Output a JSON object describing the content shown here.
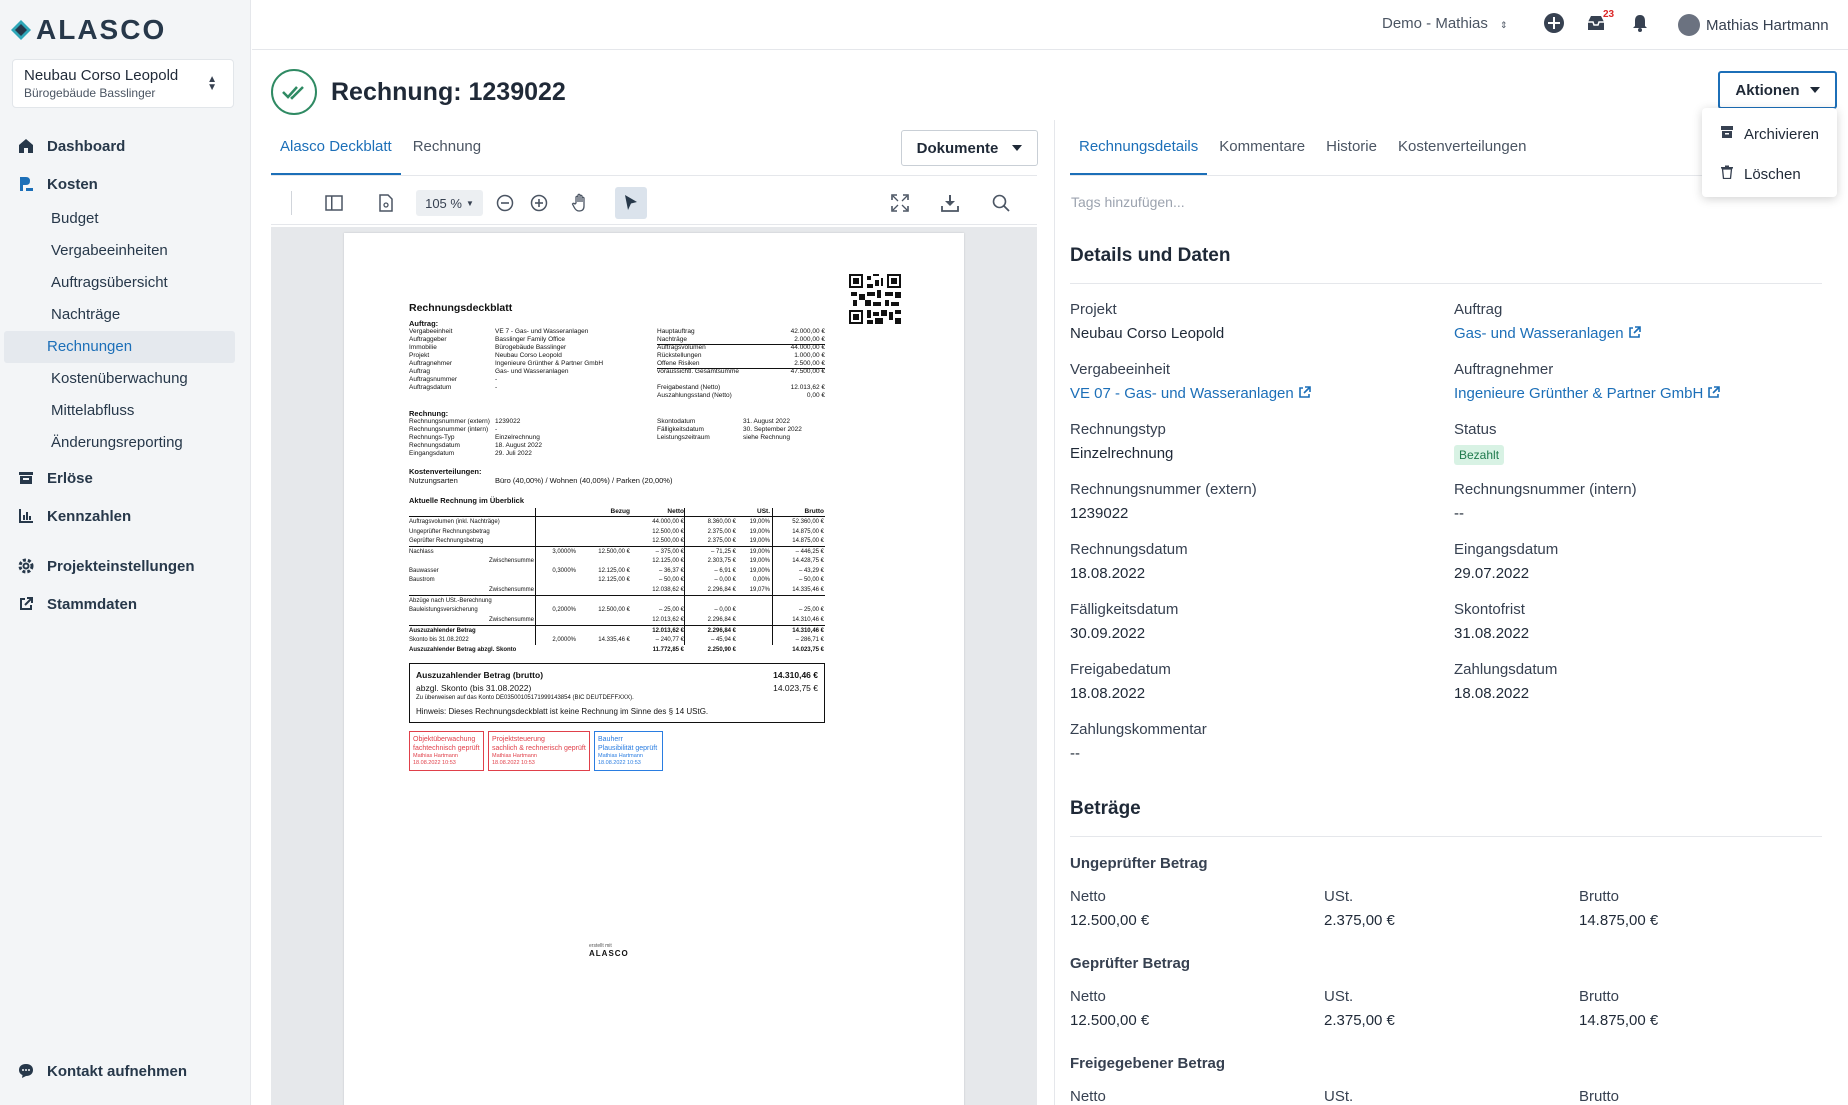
{
  "sidebar": {
    "logo_text": "ALASCO",
    "project": {
      "name": "Neubau Corso Leopold",
      "building": "Bürogebäude Basslinger"
    },
    "nav": {
      "dashboard": "Dashboard",
      "kosten": "Kosten",
      "budget": "Budget",
      "vergabeeinheiten": "Vergabeeinheiten",
      "auftragsuebersicht": "Auftragsübersicht",
      "nachtraege": "Nachträge",
      "rechnungen": "Rechnungen",
      "kostenueberwachung": "Kostenüberwachung",
      "mittelabfluss": "Mittelabfluss",
      "aenderungsreporting": "Änderungsreporting",
      "erloese": "Erlöse",
      "kennzahlen": "Kennzahlen",
      "projekteinstellungen": "Projekteinstellungen",
      "stammdaten": "Stammdaten",
      "kontakt": "Kontakt aufnehmen"
    }
  },
  "topbar": {
    "org": "Demo - Mathias",
    "inbox_badge": "23",
    "user_name": "Mathias Hartmann"
  },
  "page": {
    "title": "Rechnung: 1239022",
    "actions_label": "Aktionen",
    "actions_menu": {
      "archive": "Archivieren",
      "delete": "Löschen"
    }
  },
  "left_panel": {
    "tabs": {
      "deckblatt": "Alasco Deckblatt",
      "rechnung": "Rechnung"
    },
    "documents_button": "Dokumente",
    "zoom": "105 %"
  },
  "pdf": {
    "heading": "Rechnungsdeckblatt",
    "auftrag_heading": "Auftrag:",
    "auftrag_rows": [
      [
        "Vergabeeinheit",
        "VE 7 - Gas- und Wasseranlagen"
      ],
      [
        "Auftraggeber",
        "Basslinger Family Office"
      ],
      [
        "Immobilie",
        "Bürogebäude Basslinger"
      ],
      [
        "Projekt",
        "Neubau Corso Leopold"
      ],
      [
        "Auftragnehmer",
        "Ingenieure Grünther & Partner GmbH"
      ],
      [
        "Auftrag",
        "Gas- und Wasseranlagen"
      ],
      [
        "Auftragsnummer",
        "-"
      ],
      [
        "Auftragsdatum",
        "-"
      ]
    ],
    "auftrag_sums": [
      [
        "Hauptauftrag",
        "42.000,00 €"
      ],
      [
        "Nachträge",
        "2.000,00 €"
      ],
      [
        "Auftragsvolumen",
        "44.000,00 €"
      ],
      [
        "Rückstellungen",
        "1.000,00 €"
      ],
      [
        "Offene Risiken",
        "2.500,00 €"
      ],
      [
        "voraussichtl. Gesamtsumme",
        "47.500,00 €"
      ],
      [
        "",
        ""
      ],
      [
        "Freigabestand (Netto)",
        "12.013,62 €"
      ],
      [
        "Auszahlungsstand (Netto)",
        "0,00 €"
      ]
    ],
    "rechnung_heading": "Rechnung:",
    "rechnung_rows": [
      [
        "Rechnungsnummer (extern)",
        "1239022"
      ],
      [
        "Rechnungsnummer (intern)",
        "-"
      ],
      [
        "Rechnungs-Typ",
        "Einzelrechnung"
      ],
      [
        "Rechnungsdatum",
        "18. August 2022"
      ],
      [
        "Eingangsdatum",
        "29. Juli 2022"
      ]
    ],
    "rechnung_right": [
      [
        "Skontodatum",
        "31. August 2022"
      ],
      [
        "Fälligkeitsdatum",
        "30. September 2022"
      ],
      [
        "Leistungszeitraum",
        "siehe Rechnung"
      ]
    ],
    "kv_heading": "Kostenverteilungen:",
    "kv_label": "Nutzungsarten",
    "kv_value": "Büro (40,00%) / Wohnen (40,00%) / Parken (20,00%)",
    "table_heading": "Aktuelle Rechnung im Überblick",
    "table_cols": [
      "Bezug",
      "Netto",
      "USt.",
      "Brutto"
    ],
    "table_rows": [
      [
        "Auftragsvolumen (inkl. Nachträge)",
        "",
        "",
        "44.000,00 €",
        "8.360,00 €",
        "19,00%",
        "52.360,00 €"
      ],
      [
        "Ungeprüfter Rechnungsbetrag",
        "",
        "",
        "12.500,00 €",
        "2.375,00 €",
        "19,00%",
        "14.875,00 €"
      ],
      [
        "Geprüfter Rechnungsbetrag",
        "",
        "",
        "12.500,00 €",
        "2.375,00 €",
        "19,00%",
        "14.875,00 €"
      ],
      [
        "Nachlass",
        "3,0000%",
        "12.500,00 €",
        "– 375,00 €",
        "– 71,25 €",
        "19,00%",
        "– 446,25 €"
      ],
      [
        "Zwischensumme",
        "",
        "",
        "12.125,00 €",
        "2.303,75 €",
        "19,00%",
        "14.428,75 €"
      ],
      [
        "Bauwasser",
        "0,3000%",
        "12.125,00 €",
        "– 36,37 €",
        "– 6,91 €",
        "19,00%",
        "– 43,29 €"
      ],
      [
        "Baustrom",
        "",
        "12.125,00 €",
        "– 50,00 €",
        "– 0,00 €",
        "0,00%",
        "– 50,00 €"
      ],
      [
        "Zwischensumme",
        "",
        "",
        "12.038,62 €",
        "2.296,84 €",
        "19,07%",
        "14.335,46 €"
      ],
      [
        "Abzüge nach USt.-Berechnung",
        "",
        "",
        "",
        "",
        "",
        ""
      ],
      [
        "Bauleistungsversicherung",
        "0,2000%",
        "12.500,00 €",
        "– 25,00 €",
        "– 0,00 €",
        "",
        "– 25,00 €"
      ],
      [
        "Zwischensumme",
        "",
        "",
        "12.013,62 €",
        "2.296,84 €",
        "",
        "14.310,46 €"
      ],
      [
        "Auszuzahlender Betrag",
        "",
        "",
        "12.013,62 €",
        "2.296,84 €",
        "",
        "14.310,46 €"
      ],
      [
        "Skonto bis 31.08.2022",
        "2,0000%",
        "14.335,46 €",
        "– 240,77 €",
        "– 45,94 €",
        "",
        "– 286,71 €"
      ],
      [
        "Auszuzahlender Betrag abzgl. Skonto",
        "",
        "",
        "11.772,85 €",
        "2.250,90 €",
        "",
        "14.023,75 €"
      ]
    ],
    "summary_box": {
      "label1": "Auszuzahlender Betrag (brutto)",
      "value1": "14.310,46 €",
      "label2": "abzgl. Skonto (bis 31.08.2022)",
      "value2": "14.023,75 €",
      "transfer": "Zu überweisen auf das Konto DE03500105171999143854 (BIC DEUTDEFFXXX).",
      "note": "Hinweis: Dieses Rechnungsdeckblatt ist keine Rechnung im Sinne des § 14 UStG."
    },
    "stamps": [
      {
        "l1": "Objektüberwachung",
        "l2": "fachtechnisch geprüft",
        "l3": "Mathias Hartmann",
        "l4": "18.08.2022 10:53",
        "color": "#e0404a"
      },
      {
        "l1": "Projektsteuerung",
        "l2": "sachlich & rechnerisch geprüft",
        "l3": "Mathias Hartmann",
        "l4": "18.08.2022 10:53",
        "color": "#e0404a"
      },
      {
        "l1": "Bauherr",
        "l2": "Plausibilität geprüft",
        "l3": "Mathias Hartmann",
        "l4": "18.08.2022 10:53",
        "color": "#2a7de1"
      }
    ],
    "footer_small": "erstellt mit",
    "footer_logo": "ALASCO"
  },
  "right_panel": {
    "tabs": {
      "details": "Rechnungsdetails",
      "kommentare": "Kommentare",
      "historie": "Historie",
      "kostenverteilungen": "Kostenverteilungen"
    },
    "tags_placeholder": "Tags hinzufügen...",
    "details_title": "Details und Daten",
    "fields": {
      "projekt_label": "Projekt",
      "projekt": "Neubau Corso Leopold",
      "auftrag_label": "Auftrag",
      "auftrag": "Gas- und Wasseranlagen",
      "vergabe_label": "Vergabeeinheit",
      "vergabe": "VE 07 - Gas- und Wasseranlagen",
      "auftragnehmer_label": "Auftragnehmer",
      "auftragnehmer": "Ingenieure Grünther & Partner GmbH",
      "typ_label": "Rechnungstyp",
      "typ": "Einzelrechnung",
      "status_label": "Status",
      "status": "Bezahlt",
      "nr_ext_label": "Rechnungsnummer (extern)",
      "nr_ext": "1239022",
      "nr_int_label": "Rechnungsnummer (intern)",
      "nr_int": "--",
      "datum_label": "Rechnungsdatum",
      "datum": "18.08.2022",
      "eingang_label": "Eingangsdatum",
      "eingang": "29.07.2022",
      "faellig_label": "Fälligkeitsdatum",
      "faellig": "30.09.2022",
      "skonto_label": "Skontofrist",
      "skonto": "31.08.2022",
      "freigabe_label": "Freigabedatum",
      "freigabe": "18.08.2022",
      "zahlung_label": "Zahlungsdatum",
      "zahlung": "18.08.2022",
      "kommentar_label": "Zahlungskommentar",
      "kommentar": "--"
    },
    "betraege_title": "Beträge",
    "ungeprueft": {
      "title": "Ungeprüfter Betrag",
      "netto_label": "Netto",
      "netto": "12.500,00 €",
      "ust_label": "USt.",
      "ust": "2.375,00 €",
      "brutto_label": "Brutto",
      "brutto": "14.875,00 €"
    },
    "geprueft": {
      "title": "Geprüfter Betrag",
      "netto_label": "Netto",
      "netto": "12.500,00 €",
      "ust_label": "USt.",
      "ust": "2.375,00 €",
      "brutto_label": "Brutto",
      "brutto": "14.875,00 €"
    },
    "freigegeben": {
      "title": "Freigegebener Betrag",
      "netto_label": "Netto",
      "ust_label": "USt.",
      "brutto_label": "Brutto"
    }
  },
  "colors": {
    "accent": "#1c6fb8",
    "success": "#2f8a63",
    "status_bg": "#d8f2e4"
  }
}
